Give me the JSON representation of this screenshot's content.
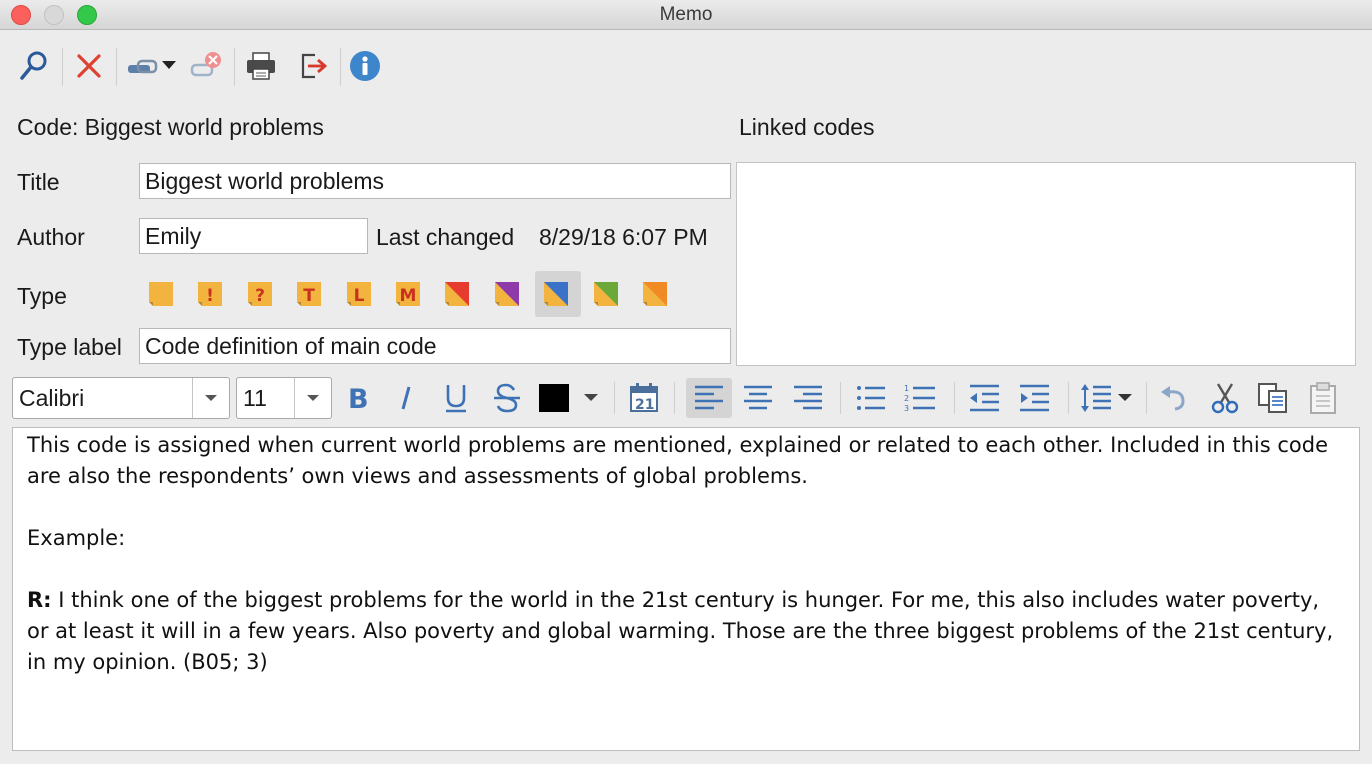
{
  "window": {
    "title": "Memo"
  },
  "toolbar": {
    "items": [
      {
        "icon": "search-icon"
      },
      {
        "icon": "delete-icon"
      },
      {
        "icon": "link-dropdown-icon"
      },
      {
        "icon": "unlink-icon"
      },
      {
        "icon": "print-icon"
      },
      {
        "icon": "export-icon"
      },
      {
        "icon": "info-icon"
      }
    ]
  },
  "header": {
    "code_label": "Code: Biggest world problems",
    "linked_codes_label": "Linked codes"
  },
  "form": {
    "title_label": "Title",
    "title_value": "Biggest world problems",
    "author_label": "Author",
    "author_value": "Emily",
    "last_changed_label": "Last changed",
    "last_changed_value": "8/29/18 6:07 PM",
    "type_label": "Type",
    "type_label_label": "Type label",
    "type_label_value": "Code definition of main code",
    "types": [
      {
        "kind": "plain",
        "letter": "",
        "color": "#f3b43f"
      },
      {
        "kind": "letter",
        "letter": "!",
        "color": "#f3b43f"
      },
      {
        "kind": "letter",
        "letter": "?",
        "color": "#f3b43f"
      },
      {
        "kind": "letter",
        "letter": "T",
        "color": "#f3b43f"
      },
      {
        "kind": "letter",
        "letter": "L",
        "color": "#f3b43f"
      },
      {
        "kind": "letter",
        "letter": "M",
        "color": "#f3b43f"
      },
      {
        "kind": "diag",
        "letter": "",
        "color": "#e63b2e"
      },
      {
        "kind": "diag",
        "letter": "",
        "color": "#8e3aa8"
      },
      {
        "kind": "diag",
        "letter": "",
        "color": "#3a72c8",
        "selected": true
      },
      {
        "kind": "diag",
        "letter": "",
        "color": "#6aa83a"
      },
      {
        "kind": "diag",
        "letter": "",
        "color": "#f08a24"
      }
    ]
  },
  "format_bar": {
    "font": "Calibri",
    "size": "11",
    "text_color": "#000000",
    "buttons": [
      "bold-icon",
      "italic-icon",
      "underline-icon",
      "strikethrough-icon",
      "text-color-icon",
      "date-icon",
      "align-left-icon",
      "align-center-icon",
      "align-right-icon",
      "bullet-list-icon",
      "numbered-list-icon",
      "outdent-icon",
      "indent-icon",
      "line-spacing-icon",
      "undo-icon",
      "cut-icon",
      "copy-icon",
      "paste-icon"
    ],
    "date_glyph": "21"
  },
  "memo": {
    "para1": "This code is assigned when current world problems are mentioned, explained or related to each other. Included in this code are also the respondents’ own views and assessments of global problems.",
    "para2": "Example:",
    "para3_prefix": "R:",
    "para3_text": " I think one of the biggest problems for the world in the 21st century is hunger. For me, this also includes water poverty, or at least it will in a few years. Also poverty and global warming. Those are the three biggest problems of the 21st century, in my opinion. (B05; 3)"
  }
}
